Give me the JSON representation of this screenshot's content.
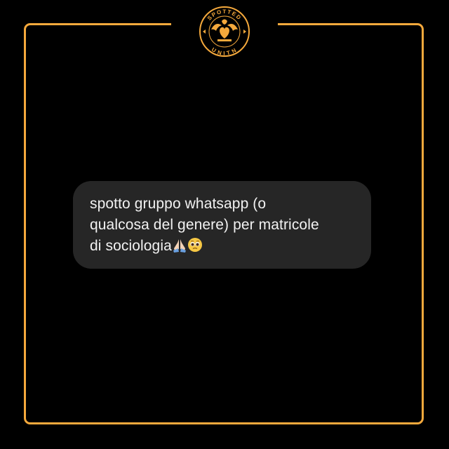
{
  "post": {
    "line1": "spotto gruppo whatsapp (o",
    "line2": "qualcosa del genere) per matricole",
    "line3": "di sociologia"
  },
  "logo": {
    "top_text": "SPOTTED",
    "bottom_text": "UNITN",
    "icon": "eagle-heart-emblem"
  },
  "icons": {
    "emoji1": "folded-hands-icon",
    "emoji2": "pleading-face-icon"
  },
  "colors": {
    "background": "#000000",
    "frame": "#f5a93c",
    "bubble": "#262626",
    "text": "#f2f2f2"
  }
}
